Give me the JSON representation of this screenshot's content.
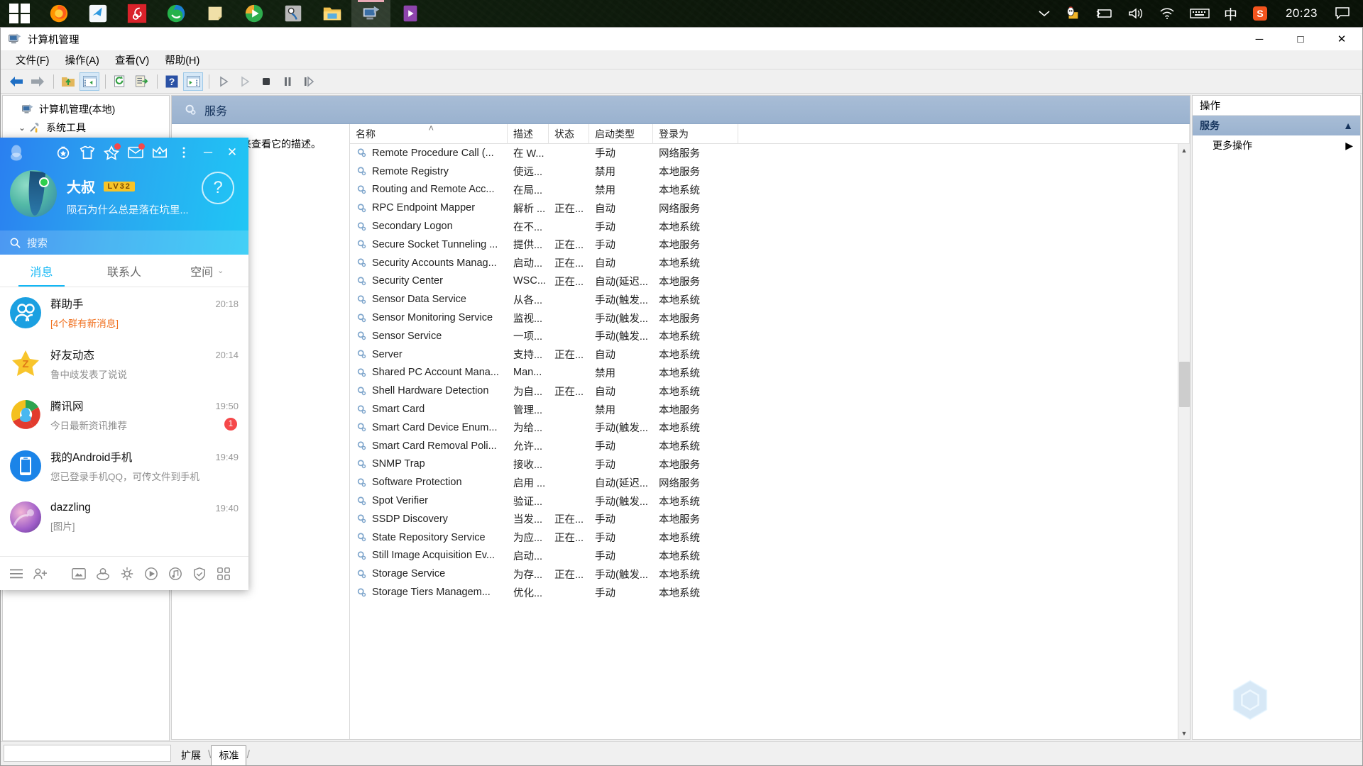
{
  "taskbar": {
    "start_label": "start",
    "items": [
      {
        "name": "start-button",
        "icon": "windows-logo-icon"
      },
      {
        "name": "taskbar-firefox",
        "icon": "firefox-icon"
      },
      {
        "name": "taskbar-app-blue-bird",
        "icon": "blue-bird-icon"
      },
      {
        "name": "taskbar-netease-music",
        "icon": "netease-music-icon"
      },
      {
        "name": "taskbar-browser-green",
        "icon": "globe-browser-icon"
      },
      {
        "name": "taskbar-notepad",
        "icon": "sticky-note-icon"
      },
      {
        "name": "taskbar-media-player",
        "icon": "play-media-icon"
      },
      {
        "name": "taskbar-screenshot-tool",
        "icon": "screenshot-tool-icon"
      },
      {
        "name": "taskbar-file-explorer",
        "icon": "folder-icon"
      },
      {
        "name": "taskbar-computer-management",
        "icon": "computer-management-icon"
      },
      {
        "name": "taskbar-video-player",
        "icon": "video-player-icon"
      }
    ],
    "tray": {
      "chevron": "chevron-up-icon",
      "qq_penguin": "qq-penguin-icon",
      "battery": "battery-icon",
      "volume": "volume-icon",
      "wifi": "wifi-icon",
      "keyboard": "keyboard-icon",
      "ime": "中",
      "sogou": "S",
      "time": "20:23",
      "notification": "notification-icon"
    }
  },
  "computer_management": {
    "title": "计算机管理",
    "window_buttons": {
      "minimize": "─",
      "maximize": "□",
      "close": "✕"
    },
    "menus": [
      "文件(F)",
      "操作(A)",
      "查看(V)",
      "帮助(H)"
    ],
    "toolbar": [
      {
        "name": "back-button",
        "icon": "arrow-left-icon"
      },
      {
        "name": "forward-button",
        "icon": "arrow-right-icon"
      },
      {
        "name": "up-folder-button",
        "icon": "folder-up-icon"
      },
      {
        "name": "show-hide-tree-button",
        "icon": "tree-pane-icon"
      },
      {
        "name": "refresh-button",
        "icon": "refresh-icon"
      },
      {
        "name": "export-list-button",
        "icon": "export-list-icon"
      },
      {
        "name": "help-button",
        "icon": "help-question-icon"
      },
      {
        "name": "show-action-pane-button",
        "icon": "action-pane-icon"
      },
      {
        "name": "start-service-button",
        "icon": "play-icon"
      },
      {
        "name": "resume-service-button",
        "icon": "play-outline-icon"
      },
      {
        "name": "stop-service-button",
        "icon": "stop-icon"
      },
      {
        "name": "pause-service-button",
        "icon": "pause-icon"
      },
      {
        "name": "restart-service-button",
        "icon": "step-icon"
      }
    ],
    "tree": [
      {
        "label": "计算机管理(本地)",
        "icon": "computer-icon",
        "twisty": "",
        "indent": 0
      },
      {
        "label": "系统工具",
        "icon": "tools-icon",
        "twisty": "⌄",
        "indent": 0
      }
    ],
    "services_pane": {
      "header": "服务",
      "header_icon": "gear-icon",
      "left_hint": "选择一个项目来查看它的描述。",
      "columns": [
        "名称",
        "描述",
        "状态",
        "启动类型",
        "登录为"
      ],
      "sort_indicator": "˄",
      "rows": [
        {
          "name": "Remote Procedure Call (...",
          "desc": "在 W...",
          "state": "",
          "startup": "手动",
          "logon": "网络服务"
        },
        {
          "name": "Remote Registry",
          "desc": "使远...",
          "state": "",
          "startup": "禁用",
          "logon": "本地服务"
        },
        {
          "name": "Routing and Remote Acc...",
          "desc": "在局...",
          "state": "",
          "startup": "禁用",
          "logon": "本地系统"
        },
        {
          "name": "RPC Endpoint Mapper",
          "desc": "解析 ...",
          "state": "正在...",
          "startup": "自动",
          "logon": "网络服务"
        },
        {
          "name": "Secondary Logon",
          "desc": "在不...",
          "state": "",
          "startup": "手动",
          "logon": "本地系统"
        },
        {
          "name": "Secure Socket Tunneling ...",
          "desc": "提供...",
          "state": "正在...",
          "startup": "手动",
          "logon": "本地服务"
        },
        {
          "name": "Security Accounts Manag...",
          "desc": "启动...",
          "state": "正在...",
          "startup": "自动",
          "logon": "本地系统"
        },
        {
          "name": "Security Center",
          "desc": "WSC...",
          "state": "正在...",
          "startup": "自动(延迟...",
          "logon": "本地服务"
        },
        {
          "name": "Sensor Data Service",
          "desc": "从各...",
          "state": "",
          "startup": "手动(触发...",
          "logon": "本地系统"
        },
        {
          "name": "Sensor Monitoring Service",
          "desc": "监视...",
          "state": "",
          "startup": "手动(触发...",
          "logon": "本地服务"
        },
        {
          "name": "Sensor Service",
          "desc": "一项...",
          "state": "",
          "startup": "手动(触发...",
          "logon": "本地系统"
        },
        {
          "name": "Server",
          "desc": "支持...",
          "state": "正在...",
          "startup": "自动",
          "logon": "本地系统"
        },
        {
          "name": "Shared PC Account Mana...",
          "desc": "Man...",
          "state": "",
          "startup": "禁用",
          "logon": "本地系统"
        },
        {
          "name": "Shell Hardware Detection",
          "desc": "为自...",
          "state": "正在...",
          "startup": "自动",
          "logon": "本地系统"
        },
        {
          "name": "Smart Card",
          "desc": "管理...",
          "state": "",
          "startup": "禁用",
          "logon": "本地服务"
        },
        {
          "name": "Smart Card Device Enum...",
          "desc": "为给...",
          "state": "",
          "startup": "手动(触发...",
          "logon": "本地系统"
        },
        {
          "name": "Smart Card Removal Poli...",
          "desc": "允许...",
          "state": "",
          "startup": "手动",
          "logon": "本地系统"
        },
        {
          "name": "SNMP Trap",
          "desc": "接收...",
          "state": "",
          "startup": "手动",
          "logon": "本地服务"
        },
        {
          "name": "Software Protection",
          "desc": "启用 ...",
          "state": "",
          "startup": "自动(延迟...",
          "logon": "网络服务"
        },
        {
          "name": "Spot Verifier",
          "desc": "验证...",
          "state": "",
          "startup": "手动(触发...",
          "logon": "本地系统"
        },
        {
          "name": "SSDP Discovery",
          "desc": "当发...",
          "state": "正在...",
          "startup": "手动",
          "logon": "本地服务"
        },
        {
          "name": "State Repository Service",
          "desc": "为应...",
          "state": "正在...",
          "startup": "手动",
          "logon": "本地系统"
        },
        {
          "name": "Still Image Acquisition Ev...",
          "desc": "启动...",
          "state": "",
          "startup": "手动",
          "logon": "本地系统"
        },
        {
          "name": "Storage Service",
          "desc": "为存...",
          "state": "正在...",
          "startup": "手动(触发...",
          "logon": "本地系统"
        },
        {
          "name": "Storage Tiers Managem...",
          "desc": "优化...",
          "state": "",
          "startup": "手动",
          "logon": "本地系统"
        }
      ],
      "tabs": [
        "扩展",
        "标准"
      ],
      "active_tab": "标准"
    },
    "actions_pane": {
      "title": "操作",
      "group": "服务",
      "group_collapse_icon": "chevron-up-icon",
      "items": [
        {
          "label": "更多操作",
          "submenu_icon": "chevron-right-icon"
        }
      ]
    }
  },
  "qq": {
    "titlebar_icons": [
      {
        "name": "qq-penguin-icon",
        "dot": false
      },
      {
        "name": "medal-badge-icon",
        "dot": false
      },
      {
        "name": "tshirt-dressup-icon",
        "dot": false
      },
      {
        "name": "star-favorites-icon",
        "dot": true
      },
      {
        "name": "mail-envelope-icon",
        "dot": true
      },
      {
        "name": "crown-vip-icon",
        "dot": false
      },
      {
        "name": "more-options-icon",
        "dot": false
      }
    ],
    "minimize": "─",
    "close": "✕",
    "profile": {
      "nickname": "大叔",
      "level": "LV32",
      "signature": "陨石为什么总是落在坑里...",
      "help_icon": "question-circle-icon"
    },
    "search": {
      "placeholder": "搜索",
      "icon": "search-icon"
    },
    "tabs": [
      {
        "label": "消息",
        "active": true
      },
      {
        "label": "联系人",
        "active": false
      },
      {
        "label": "空间",
        "active": false,
        "chevron": "⌄"
      }
    ],
    "chats": [
      {
        "name": "群助手",
        "sub": "[4个群有新消息]",
        "time": "20:18",
        "sub_highlight": true,
        "badge": "",
        "avatar": "group-assistant-icon"
      },
      {
        "name": "好友动态",
        "sub": "鲁中歧发表了说说",
        "time": "20:14",
        "sub_highlight": false,
        "badge": "",
        "avatar": "qzone-star-icon"
      },
      {
        "name": "腾讯网",
        "sub": "今日最新资讯推荐",
        "time": "19:50",
        "sub_highlight": false,
        "badge": "1",
        "avatar": "tencent-news-icon"
      },
      {
        "name": "我的Android手机",
        "sub": "您已登录手机QQ，可传文件到手机",
        "time": "19:49",
        "sub_highlight": false,
        "badge": "",
        "avatar": "android-phone-icon"
      },
      {
        "name": "dazzling",
        "sub": "[图片]",
        "time": "19:40",
        "sub_highlight": false,
        "badge": "",
        "avatar": "user-avatar-icon"
      }
    ],
    "bottom_icons": [
      {
        "name": "main-menu-icon"
      },
      {
        "name": "add-friend-icon"
      },
      {
        "name": "qq-group-icon"
      },
      {
        "name": "file-transfer-icon"
      },
      {
        "name": "qq-service-icon"
      },
      {
        "name": "video-icon"
      },
      {
        "name": "qq-music-icon"
      },
      {
        "name": "shield-guard-icon"
      },
      {
        "name": "app-grid-icon"
      }
    ]
  },
  "watermark": {
    "text": "",
    "icon": "hexagon-logo-icon"
  },
  "colors": {
    "qq_blue": "#12b7f5",
    "accent_red": "#f5484a",
    "orange": "#f06f1d",
    "pane_header": "#9ab2cf",
    "selection": "#d6e8f7"
  }
}
